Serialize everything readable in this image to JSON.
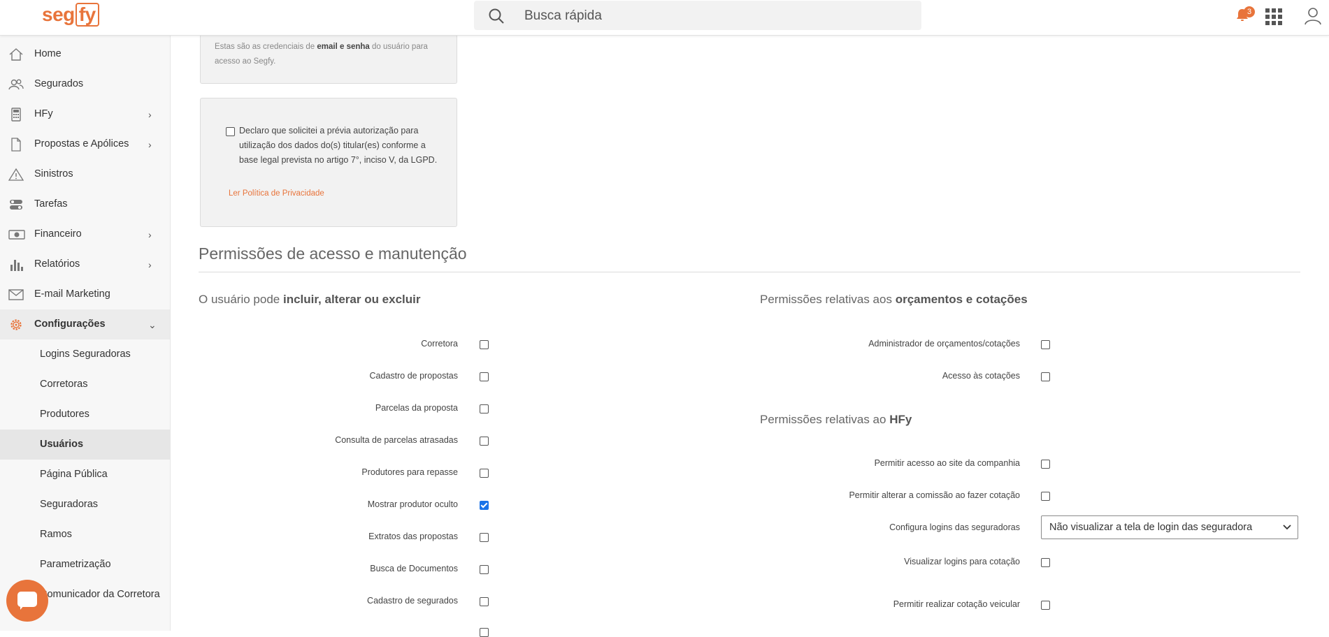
{
  "header": {
    "logo_seg": "seg",
    "logo_fy": "fy",
    "search_placeholder": "Busca rápida",
    "notification_count": "3"
  },
  "sidebar": {
    "items": [
      {
        "label": "Home",
        "icon": "home-icon"
      },
      {
        "label": "Segurados",
        "icon": "users-icon"
      },
      {
        "label": "HFy",
        "icon": "calculator-icon",
        "chevron": "›"
      },
      {
        "label": "Propostas e Apólices",
        "icon": "document-icon",
        "chevron": "›"
      },
      {
        "label": "Sinistros",
        "icon": "warning-icon"
      },
      {
        "label": "Tarefas",
        "icon": "tasks-icon"
      },
      {
        "label": "Financeiro",
        "icon": "money-icon",
        "chevron": "›"
      },
      {
        "label": "Relatórios",
        "icon": "bar-chart-icon",
        "chevron": "›"
      },
      {
        "label": "E-mail Marketing",
        "icon": "mail-icon"
      },
      {
        "label": "Configurações",
        "icon": "gear-icon",
        "chevron": "⌄"
      }
    ],
    "subitems": [
      {
        "label": "Logins Seguradoras"
      },
      {
        "label": "Corretoras"
      },
      {
        "label": "Produtores"
      },
      {
        "label": "Usuários"
      },
      {
        "label": "Página Pública"
      },
      {
        "label": "Seguradoras"
      },
      {
        "label": "Ramos"
      },
      {
        "label": "Parametrização"
      },
      {
        "label": "Comunicador da Corretora"
      }
    ]
  },
  "credentials_card": {
    "text_before": "Estas são as credenciais de ",
    "text_bold": "email e senha",
    "text_after": " do usuário para acesso ao Segfy."
  },
  "consent_card": {
    "text": "Declaro que solicitei a prévia autorização para utilização dos dados do(s) titular(es) conforme a base legal prevista no artigo 7°, inciso V, da LGPD.",
    "link": "Ler Política de Privacidade"
  },
  "permissions": {
    "title": "Permissões de acesso e manutenção",
    "left_title_normal": "O usuário pode ",
    "left_title_bold": "incluir, alterar ou excluir",
    "left_rows": [
      {
        "label": "Corretora",
        "checked": false
      },
      {
        "label": "Cadastro de propostas",
        "checked": false
      },
      {
        "label": "Parcelas da proposta",
        "checked": false
      },
      {
        "label": "Consulta de parcelas atrasadas",
        "checked": false
      },
      {
        "label": "Produtores para repasse",
        "checked": false
      },
      {
        "label": "Mostrar produtor oculto",
        "checked": true
      },
      {
        "label": "Extratos das propostas",
        "checked": false
      },
      {
        "label": "Busca de Documentos",
        "checked": false
      },
      {
        "label": "Cadastro de segurados",
        "checked": false
      }
    ],
    "quotes_title_normal": "Permissões relativas aos ",
    "quotes_title_bold": "orçamentos e cotações",
    "quotes_rows": [
      {
        "label": "Administrador de orçamentos/cotações",
        "checked": false
      },
      {
        "label": "Acesso às cotações",
        "checked": false
      }
    ],
    "hfy_title_normal": "Permissões relativas ao ",
    "hfy_title_bold": "HFy",
    "hfy_rows": [
      {
        "label": "Permitir acesso ao site da companhia",
        "checked": false
      },
      {
        "label": "Permitir alterar a comissão ao fazer cotação",
        "checked": false
      }
    ],
    "logins_config_label": "Configura logins das seguradoras",
    "logins_config_value": "Não visualizar a tela de login das seguradora",
    "hfy_rows_after": [
      {
        "label": "Visualizar logins para cotação",
        "checked": false
      },
      {
        "label": "Permitir realizar cotação veicular",
        "checked": false
      }
    ]
  }
}
